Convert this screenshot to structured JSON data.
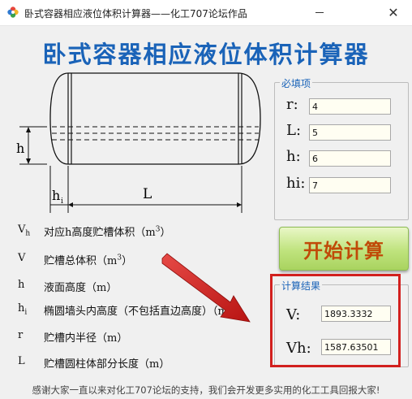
{
  "window": {
    "title": "卧式容器相应液位体积计算器——化工707论坛作品",
    "minimize": "—",
    "close": "✕"
  },
  "heading": "卧式容器相应液位体积计算器",
  "diagram": {
    "label_h": "h",
    "label_hi": "h",
    "label_hi_sub": "i",
    "label_L": "L"
  },
  "legend": [
    {
      "sym": "V",
      "sub": "h",
      "desc": "对应h高度贮槽体积（m",
      "sup": "3",
      "desc_end": "）"
    },
    {
      "sym": "V",
      "sub": "",
      "desc": "贮槽总体积（m",
      "sup": "3",
      "desc_end": "）"
    },
    {
      "sym": "h",
      "sub": "",
      "desc": "液面高度（m）",
      "sup": "",
      "desc_end": ""
    },
    {
      "sym": "h",
      "sub": "i",
      "desc": "椭圆墙头内高度（不包括直边高度）（m）",
      "sup": "",
      "desc_end": ""
    },
    {
      "sym": "r",
      "sub": "",
      "desc": "贮槽内半径（m）",
      "sup": "",
      "desc_end": ""
    },
    {
      "sym": "L",
      "sub": "",
      "desc": "贮槽圆柱体部分长度（m）",
      "sup": "",
      "desc_end": ""
    }
  ],
  "required": {
    "title": "必填项",
    "fields": [
      {
        "label": "r:",
        "value": "4"
      },
      {
        "label": "L:",
        "value": "5"
      },
      {
        "label": "h:",
        "value": "6"
      },
      {
        "label": "hi:",
        "value": "7"
      }
    ]
  },
  "start_button": "开始计算",
  "results": {
    "title": "计算结果",
    "fields": [
      {
        "label": "V:",
        "value": "1893.3332"
      },
      {
        "label": "Vh:",
        "value": "1587.63501"
      }
    ]
  },
  "footer": "感谢大家一直以来对化工707论坛的支持，我们会开发更多实用的化工工具回报大家!",
  "colors": {
    "heading": "#1a63b8",
    "button_text": "#c04a08",
    "annotation": "#d2201e"
  }
}
